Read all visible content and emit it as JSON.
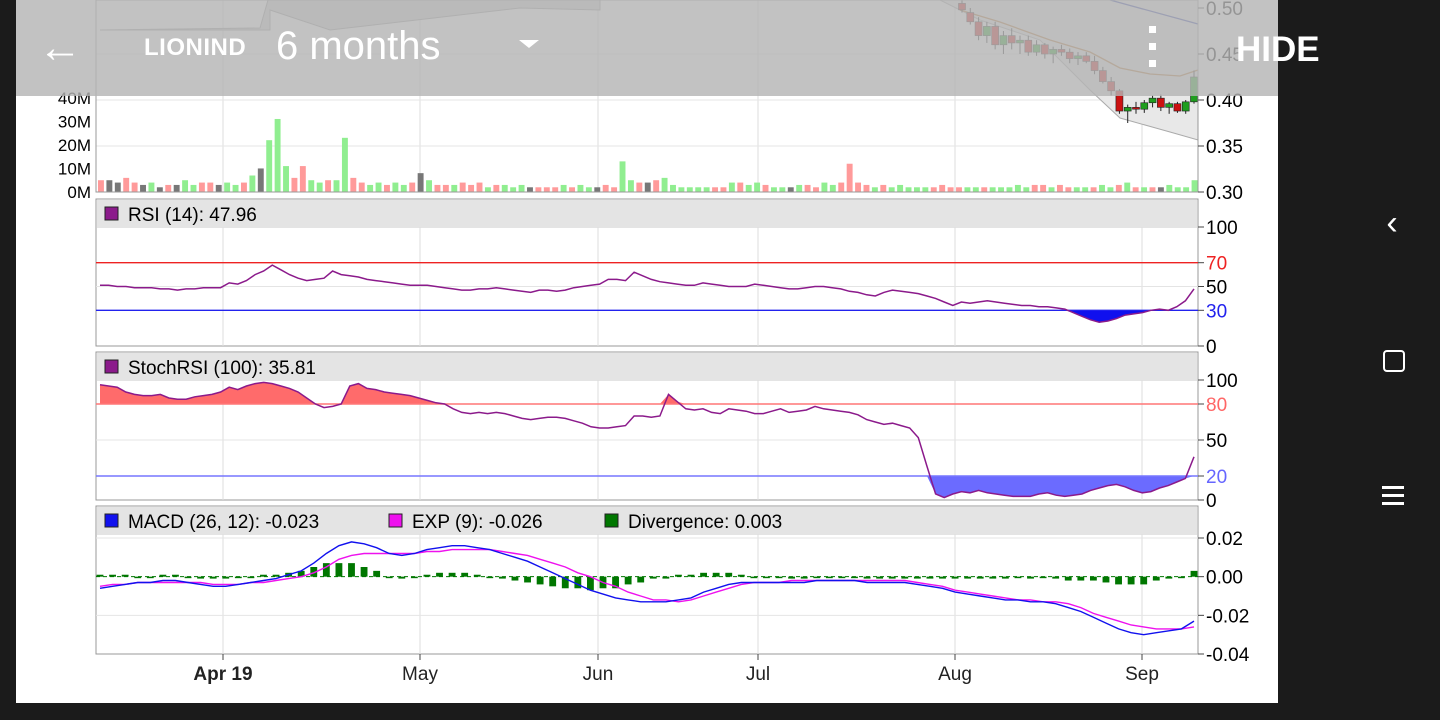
{
  "app": {
    "ticker": "LIONIND",
    "period": "6 months",
    "hide_label": "HIDE",
    "back_icon": "arrow-left-icon",
    "dropdown_icon": "caret-down-icon",
    "menu_icon": "more-vert-icon"
  },
  "system_nav": {
    "back_icon": "nav-back-icon",
    "home_icon": "nav-home-icon",
    "recents_icon": "nav-recents-icon"
  },
  "colors": {
    "up": "#90ee90",
    "down": "#ff9a9a",
    "neutral": "#777777",
    "candle_up": "#1f9e1f",
    "candle_down": "#cc1111",
    "rsi_line": "#8b1a8b",
    "macd_line": "#1111ee",
    "exp_line": "#ee11ee",
    "divergence": "#007700",
    "upper_band": "#ee2222",
    "lower_band": "#2222ee"
  },
  "chart_data": [
    {
      "type": "line",
      "panel": "price",
      "y_ticks": [
        "0.50",
        "0.45",
        "0.40",
        "0.35",
        "0.30"
      ],
      "ylim": [
        0.3,
        0.5
      ],
      "x_tick_labels": [
        "Apr 19",
        "May",
        "Jun",
        "Jul",
        "Aug",
        "Sep"
      ],
      "visible_candles": [
        {
          "o": 0.505,
          "h": 0.51,
          "l": 0.495,
          "c": 0.498
        },
        {
          "o": 0.495,
          "h": 0.5,
          "l": 0.482,
          "c": 0.485
        },
        {
          "o": 0.485,
          "h": 0.49,
          "l": 0.465,
          "c": 0.47
        },
        {
          "o": 0.47,
          "h": 0.485,
          "l": 0.462,
          "c": 0.48
        },
        {
          "o": 0.48,
          "h": 0.485,
          "l": 0.455,
          "c": 0.46
        },
        {
          "o": 0.46,
          "h": 0.475,
          "l": 0.45,
          "c": 0.47
        },
        {
          "o": 0.47,
          "h": 0.478,
          "l": 0.455,
          "c": 0.462
        },
        {
          "o": 0.462,
          "h": 0.47,
          "l": 0.45,
          "c": 0.465
        },
        {
          "o": 0.465,
          "h": 0.47,
          "l": 0.448,
          "c": 0.452
        },
        {
          "o": 0.452,
          "h": 0.465,
          "l": 0.448,
          "c": 0.46
        },
        {
          "o": 0.46,
          "h": 0.462,
          "l": 0.445,
          "c": 0.45
        },
        {
          "o": 0.45,
          "h": 0.458,
          "l": 0.44,
          "c": 0.455
        },
        {
          "o": 0.455,
          "h": 0.46,
          "l": 0.448,
          "c": 0.452
        },
        {
          "o": 0.452,
          "h": 0.456,
          "l": 0.44,
          "c": 0.445
        },
        {
          "o": 0.445,
          "h": 0.452,
          "l": 0.438,
          "c": 0.448
        },
        {
          "o": 0.448,
          "h": 0.452,
          "l": 0.44,
          "c": 0.442
        },
        {
          "o": 0.442,
          "h": 0.448,
          "l": 0.428,
          "c": 0.432
        },
        {
          "o": 0.432,
          "h": 0.436,
          "l": 0.418,
          "c": 0.42
        },
        {
          "o": 0.42,
          "h": 0.425,
          "l": 0.405,
          "c": 0.41
        },
        {
          "o": 0.41,
          "h": 0.412,
          "l": 0.385,
          "c": 0.388
        },
        {
          "o": 0.388,
          "h": 0.395,
          "l": 0.375,
          "c": 0.392
        },
        {
          "o": 0.392,
          "h": 0.398,
          "l": 0.385,
          "c": 0.39
        },
        {
          "o": 0.39,
          "h": 0.4,
          "l": 0.386,
          "c": 0.397
        },
        {
          "o": 0.397,
          "h": 0.405,
          "l": 0.392,
          "c": 0.402
        },
        {
          "o": 0.402,
          "h": 0.406,
          "l": 0.388,
          "c": 0.392
        },
        {
          "o": 0.392,
          "h": 0.398,
          "l": 0.385,
          "c": 0.396
        },
        {
          "o": 0.396,
          "h": 0.398,
          "l": 0.386,
          "c": 0.388
        },
        {
          "o": 0.388,
          "h": 0.4,
          "l": 0.385,
          "c": 0.398
        },
        {
          "o": 0.398,
          "h": 0.432,
          "l": 0.396,
          "c": 0.425
        }
      ]
    },
    {
      "type": "bar",
      "panel": "volume",
      "y_ticks": [
        "40M",
        "30M",
        "20M",
        "10M",
        "0M"
      ],
      "ylim": [
        0,
        45
      ],
      "unit": "M",
      "values": [
        5,
        5,
        4,
        6,
        4,
        3,
        4,
        2,
        3,
        3,
        5,
        3,
        4,
        4,
        3,
        4,
        3,
        4,
        7,
        10,
        22,
        31,
        11,
        6,
        11,
        5,
        4,
        5,
        5,
        23,
        6,
        4,
        3,
        4,
        3,
        4,
        3,
        4,
        8,
        5,
        3,
        3,
        3,
        4,
        3,
        4,
        2,
        3,
        3,
        2,
        3,
        2,
        2,
        2,
        2,
        3,
        2,
        3,
        2,
        2,
        3,
        2,
        13,
        5,
        4,
        4,
        5,
        6,
        3,
        2,
        2,
        2,
        2,
        2,
        2,
        4,
        4,
        3,
        4,
        3,
        2,
        2,
        2,
        3,
        3,
        2,
        4,
        3,
        4,
        12,
        4,
        3,
        2,
        3,
        2,
        3,
        2,
        2,
        2,
        2,
        3,
        2,
        2,
        2,
        2,
        2,
        2,
        2,
        2,
        3,
        2,
        3,
        3,
        2,
        3,
        2,
        2,
        2,
        2,
        3,
        2,
        3,
        4,
        2,
        2,
        2,
        2,
        3,
        2,
        2,
        5
      ],
      "directions": "dnnddnundnuuddnuudunuuudduuduudduuduudnudduddduduuunddduduundduudnduuuuuudduduuduunudduudddduduuuuudddduuduuuuuddudduuduudududnuuuu"
    },
    {
      "type": "line",
      "panel": "rsi",
      "legend": "RSI (14): 47.96",
      "y_ticks": [
        "100",
        "70",
        "50",
        "30",
        "0"
      ],
      "ylim": [
        0,
        100
      ],
      "upper_level": 70,
      "lower_level": 30,
      "values": [
        51,
        51,
        50,
        50,
        49,
        49,
        49,
        48,
        48,
        47,
        48,
        48,
        49,
        49,
        49,
        53,
        52,
        55,
        60,
        63,
        68,
        64,
        60,
        57,
        55,
        56,
        57,
        63,
        60,
        59,
        58,
        56,
        55,
        54,
        53,
        52,
        51,
        51,
        51,
        50,
        49,
        48,
        47,
        47,
        48,
        48,
        49,
        48,
        47,
        46,
        45,
        47,
        47,
        46,
        47,
        49,
        50,
        51,
        52,
        56,
        56,
        55,
        62,
        59,
        56,
        54,
        53,
        52,
        51,
        51,
        53,
        52,
        51,
        50,
        50,
        50,
        52,
        51,
        50,
        49,
        48,
        48,
        49,
        50,
        50,
        49,
        48,
        46,
        45,
        43,
        42,
        45,
        47,
        46,
        45,
        44,
        42,
        40,
        37,
        34,
        37,
        36,
        37,
        38,
        37,
        36,
        35,
        34,
        34,
        33,
        33,
        32,
        31,
        28,
        25,
        22,
        20,
        21,
        23,
        26,
        27,
        28,
        30,
        31,
        30,
        33,
        38,
        48
      ]
    },
    {
      "type": "area",
      "panel": "stochrsi",
      "legend": "StochRSI (100): 35.81",
      "y_ticks": [
        "100",
        "80",
        "50",
        "20",
        "0"
      ],
      "ylim": [
        0,
        100
      ],
      "upper_level": 80,
      "lower_level": 20,
      "values": [
        96,
        95,
        94,
        90,
        88,
        87,
        87,
        88,
        85,
        84,
        84,
        86,
        87,
        88,
        90,
        94,
        92,
        95,
        97,
        98,
        97,
        95,
        93,
        90,
        85,
        80,
        77,
        78,
        80,
        95,
        97,
        93,
        92,
        90,
        89,
        88,
        87,
        85,
        83,
        81,
        80,
        76,
        73,
        72,
        73,
        72,
        73,
        72,
        70,
        68,
        67,
        68,
        69,
        69,
        68,
        66,
        64,
        61,
        60,
        60,
        61,
        62,
        70,
        70,
        69,
        70,
        88,
        82,
        76,
        75,
        76,
        73,
        72,
        76,
        75,
        74,
        72,
        72,
        74,
        76,
        73,
        74,
        75,
        78,
        76,
        75,
        74,
        73,
        71,
        67,
        65,
        63,
        64,
        62,
        60,
        52,
        28,
        5,
        2,
        5,
        7,
        6,
        8,
        6,
        5,
        4,
        3,
        3,
        3,
        5,
        6,
        4,
        3,
        4,
        5,
        8,
        10,
        12,
        13,
        11,
        8,
        6,
        7,
        10,
        12,
        15,
        18,
        36
      ]
    },
    {
      "type": "line",
      "panel": "macd",
      "legend": [
        {
          "name": "MACD (26, 12): -0.023",
          "color": "#1111ee"
        },
        {
          "name": "EXP (9): -0.026",
          "color": "#ee11ee"
        },
        {
          "name": "Divergence: 0.003",
          "color": "#007700"
        }
      ],
      "y_ticks": [
        "0.02",
        "0.00",
        "-0.02",
        "-0.04"
      ],
      "ylim": [
        -0.04,
        0.02
      ],
      "macd": [
        -0.006,
        -0.005,
        -0.004,
        -0.003,
        -0.003,
        -0.002,
        -0.002,
        -0.003,
        -0.004,
        -0.005,
        -0.005,
        -0.004,
        -0.003,
        -0.002,
        -0.001,
        0.001,
        0.003,
        0.007,
        0.012,
        0.016,
        0.018,
        0.017,
        0.015,
        0.012,
        0.011,
        0.012,
        0.014,
        0.015,
        0.016,
        0.016,
        0.015,
        0.014,
        0.012,
        0.01,
        0.008,
        0.005,
        0.002,
        -0.001,
        -0.004,
        -0.007,
        -0.009,
        -0.011,
        -0.012,
        -0.013,
        -0.013,
        -0.013,
        -0.012,
        -0.011,
        -0.008,
        -0.006,
        -0.004,
        -0.003,
        -0.003,
        -0.003,
        -0.003,
        -0.003,
        -0.003,
        -0.002,
        -0.002,
        -0.002,
        -0.002,
        -0.003,
        -0.003,
        -0.003,
        -0.003,
        -0.004,
        -0.005,
        -0.006,
        -0.008,
        -0.009,
        -0.01,
        -0.011,
        -0.012,
        -0.012,
        -0.013,
        -0.013,
        -0.014,
        -0.016,
        -0.018,
        -0.021,
        -0.024,
        -0.027,
        -0.029,
        -0.03,
        -0.029,
        -0.028,
        -0.027,
        -0.023
      ],
      "exp": [
        -0.005,
        -0.004,
        -0.004,
        -0.003,
        -0.003,
        -0.003,
        -0.003,
        -0.003,
        -0.003,
        -0.004,
        -0.004,
        -0.004,
        -0.003,
        -0.003,
        -0.002,
        -0.001,
        0.0,
        0.002,
        0.005,
        0.009,
        0.011,
        0.012,
        0.012,
        0.012,
        0.012,
        0.012,
        0.013,
        0.013,
        0.014,
        0.014,
        0.014,
        0.014,
        0.013,
        0.012,
        0.011,
        0.009,
        0.007,
        0.005,
        0.002,
        0.0,
        -0.003,
        -0.005,
        -0.008,
        -0.01,
        -0.012,
        -0.012,
        -0.013,
        -0.012,
        -0.01,
        -0.008,
        -0.006,
        -0.004,
        -0.003,
        -0.003,
        -0.003,
        -0.002,
        -0.002,
        -0.002,
        -0.002,
        -0.002,
        -0.002,
        -0.002,
        -0.002,
        -0.002,
        -0.002,
        -0.003,
        -0.004,
        -0.005,
        -0.007,
        -0.008,
        -0.009,
        -0.01,
        -0.011,
        -0.012,
        -0.012,
        -0.013,
        -0.013,
        -0.014,
        -0.016,
        -0.019,
        -0.021,
        -0.023,
        -0.025,
        -0.026,
        -0.027,
        -0.027,
        -0.027,
        -0.026
      ],
      "divergence": [
        0.001,
        0.001,
        0.001,
        0.0,
        0.0,
        0.001,
        0.001,
        0.0,
        -0.001,
        -0.001,
        -0.001,
        0.0,
        0.0,
        0.001,
        0.001,
        0.002,
        0.003,
        0.005,
        0.007,
        0.007,
        0.007,
        0.005,
        0.003,
        0.0,
        -0.001,
        0.0,
        0.001,
        0.002,
        0.002,
        0.002,
        0.001,
        0.0,
        -0.001,
        -0.002,
        -0.003,
        -0.004,
        -0.005,
        -0.006,
        -0.006,
        -0.007,
        -0.006,
        -0.006,
        -0.004,
        -0.003,
        -0.001,
        -0.001,
        0.001,
        0.001,
        0.002,
        0.002,
        0.002,
        0.001,
        0.0,
        0.0,
        0.0,
        -0.001,
        -0.001,
        0.0,
        0.0,
        0.0,
        0.0,
        -0.001,
        -0.001,
        -0.001,
        -0.001,
        -0.001,
        -0.001,
        -0.001,
        -0.001,
        -0.001,
        -0.001,
        -0.001,
        -0.001,
        0.0,
        -0.001,
        0.0,
        -0.001,
        -0.002,
        -0.002,
        -0.002,
        -0.003,
        -0.004,
        -0.004,
        -0.004,
        -0.002,
        -0.001,
        0.0,
        0.003
      ]
    }
  ]
}
